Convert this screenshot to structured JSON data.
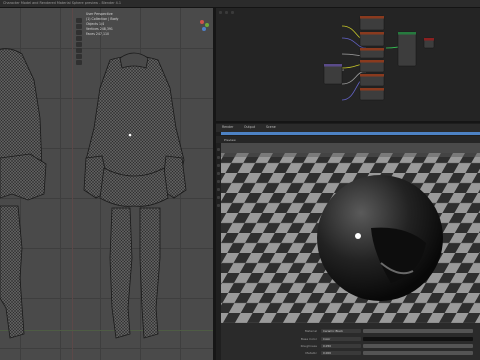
{
  "window": {
    "title": "Character Model and Rendered Material Sphere preview - Blender 4.1"
  },
  "left_viewport": {
    "stats": [
      "User Perspective",
      "(1) Collection | Body",
      "Objects 1/4",
      "Vertices 248,391",
      "Faces 247,110"
    ]
  },
  "properties": {
    "tabs": [
      "Render",
      "Output",
      "Scene"
    ],
    "panel_header": "Preview"
  },
  "render_panel": {
    "rows": [
      {
        "label": "Material",
        "value": "Ceramic Black"
      },
      {
        "label": "Base Color",
        "value": "Color"
      },
      {
        "label": "Roughness",
        "value": "0.050"
      },
      {
        "label": "Metallic",
        "value": "0.000"
      }
    ]
  },
  "colors": {
    "accent": "#4d82c4",
    "viewport_bg": "#4a4a4a",
    "node_bg": "#242424"
  }
}
